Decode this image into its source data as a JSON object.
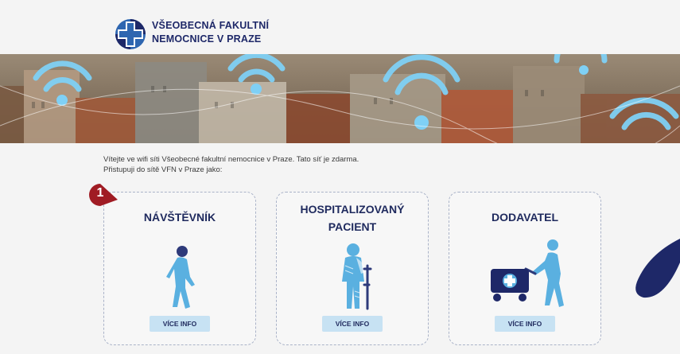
{
  "logo": {
    "line1": "VŠEOBECNÁ FAKULTNÍ",
    "line2": "NEMOCNICE V PRAZE"
  },
  "intro": {
    "line1": "Vítejte ve wifi síti Všeobecné fakultní nemocnice v Praze. Tato síť je zdarma.",
    "line2": "Přistupuji do sítě VFN v Praze jako:"
  },
  "badge": {
    "number": "1"
  },
  "cards": [
    {
      "title_line1": "NÁVŠTĚVNÍK",
      "title_line2": "",
      "button": "VÍCE INFO",
      "icon": "walking-person-icon"
    },
    {
      "title_line1": "HOSPITALIZOVANÝ",
      "title_line2": "PACIENT",
      "button": "VÍCE INFO",
      "icon": "patient-with-crutch-icon"
    },
    {
      "title_line1": "DODAVATEL",
      "title_line2": "",
      "button": "VÍCE INFO",
      "icon": "supplier-with-cart-icon"
    }
  ],
  "colors": {
    "brand_navy": "#1f2a5e",
    "brand_blue": "#2e66b0",
    "light_blue": "#5ab0e0",
    "button_bg": "#c7e2f3",
    "badge_red": "#a01c24"
  }
}
